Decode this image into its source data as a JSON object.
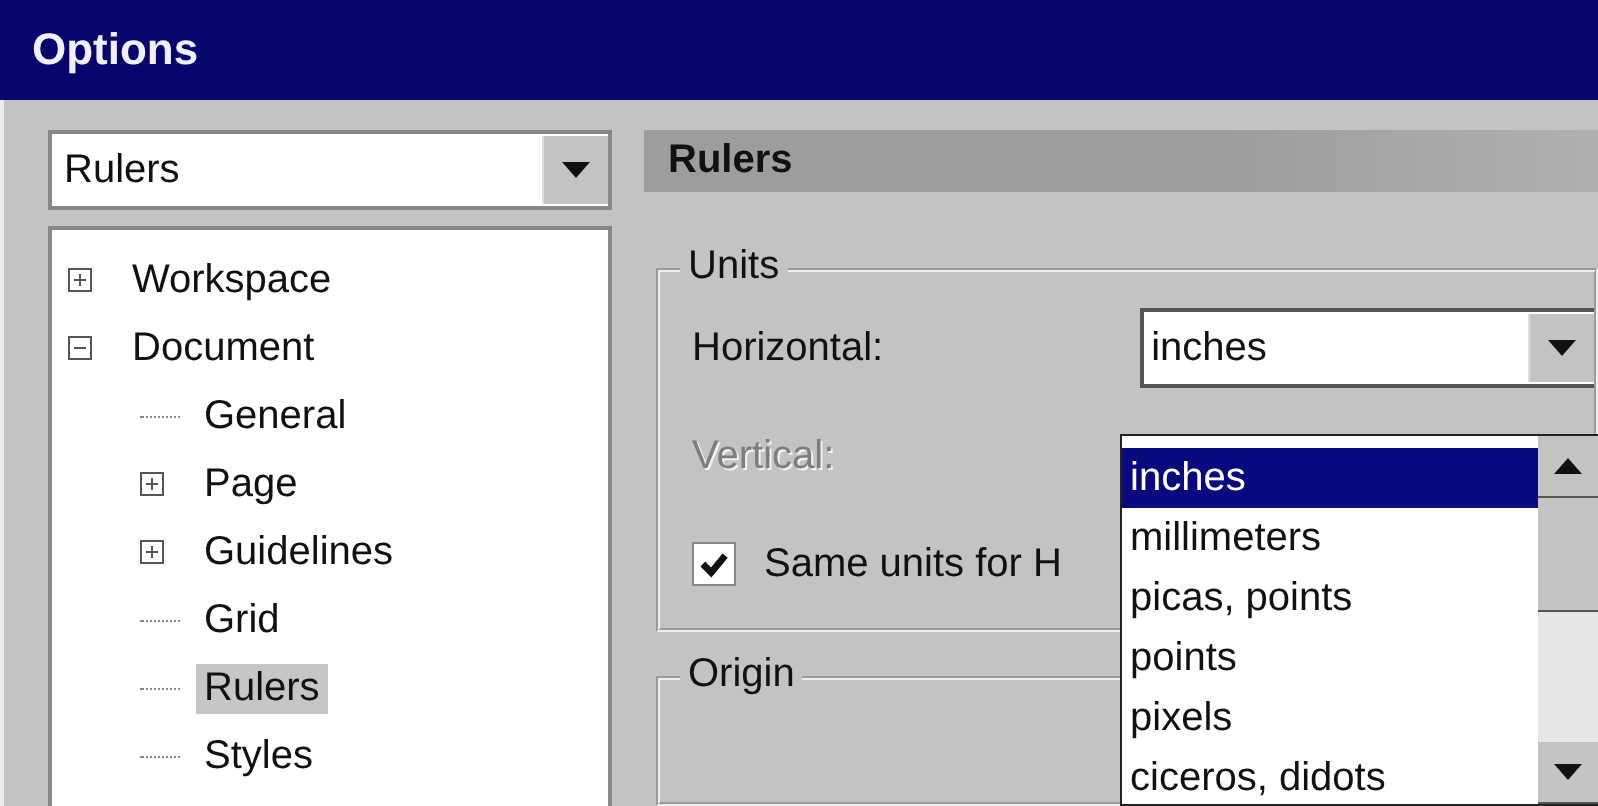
{
  "window": {
    "title": "Options"
  },
  "category_combo": {
    "value": "Rulers"
  },
  "tree": [
    {
      "label": "Workspace",
      "expanded": false,
      "selected": false
    },
    {
      "label": "Document",
      "expanded": true,
      "selected": false,
      "children": [
        {
          "label": "General",
          "selected": false
        },
        {
          "label": "Page",
          "expanded": false,
          "selected": false
        },
        {
          "label": "Guidelines",
          "expanded": false,
          "selected": false
        },
        {
          "label": "Grid",
          "selected": false
        },
        {
          "label": "Rulers",
          "selected": true
        },
        {
          "label": "Styles",
          "selected": false
        }
      ]
    }
  ],
  "panel": {
    "title": "Rulers",
    "units": {
      "title": "Units",
      "horizontal": {
        "label": "Horizontal:",
        "value": "inches"
      },
      "vertical": {
        "label": "Vertical:",
        "disabled": true
      },
      "same_units": {
        "label": "Same units for H",
        "checked": true
      },
      "dropdown": {
        "options": [
          {
            "label": "inches",
            "selected": true
          },
          {
            "label": "millimeters",
            "selected": false
          },
          {
            "label": "picas, points",
            "selected": false
          },
          {
            "label": "points",
            "selected": false
          },
          {
            "label": "pixels",
            "selected": false
          },
          {
            "label": "ciceros, didots",
            "selected": false
          }
        ]
      }
    },
    "origin": {
      "title": "Origin"
    }
  }
}
